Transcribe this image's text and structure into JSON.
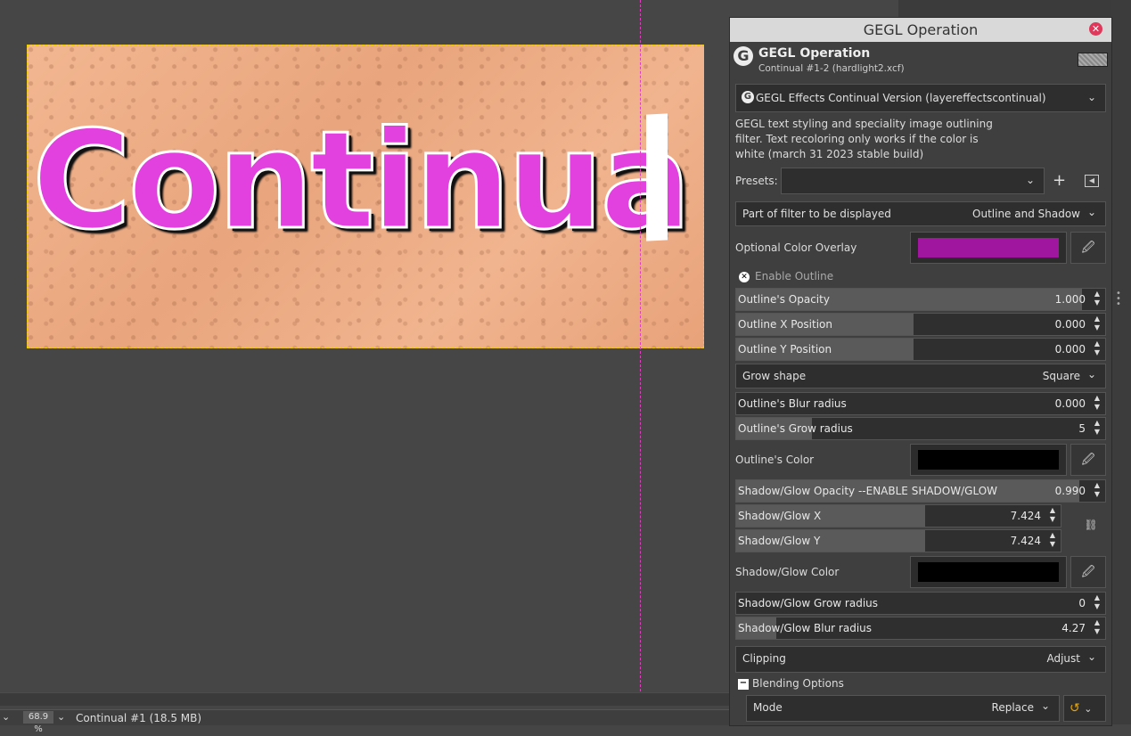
{
  "status": {
    "zoom": "68.9 %",
    "image_info": "Continual #1 (18.5 MB)"
  },
  "canvas": {
    "text": "Continua"
  },
  "dialog": {
    "title": "GEGL Operation",
    "op_title": "GEGL Operation",
    "op_subtitle": "Continual #1-2 (hardlight2.xcf)",
    "operation": "GEGL Effects Continual Version (layereffectscontinual)",
    "description": "GEGL text styling and speciality image outlining filter. Text recoloring only works if the color is white (march 31 2023 stable build)",
    "presets_label": "Presets:",
    "part_label": "Part of filter to be displayed",
    "part_value": "Outline and Shadow",
    "overlay_label": "Optional Color Overlay",
    "overlay_color": "#a0169e",
    "enable_outline": "Enable Outline",
    "outline_opacity_label": "Outline's Opacity",
    "outline_opacity": "1.000",
    "outline_x_label": "Outline X Position",
    "outline_x": "0.000",
    "outline_y_label": "Outline Y Position",
    "outline_y": "0.000",
    "grow_shape_label": "Grow shape",
    "grow_shape": "Square",
    "blur_label": "Outline's Blur radius",
    "blur": "0.000",
    "grow_label": "Outline's Grow radius",
    "grow": "5",
    "outline_color_label": "Outline's Color",
    "outline_color": "#000000",
    "shadow_opacity_label": "Shadow/Glow Opacity --ENABLE SHADOW/GLOW",
    "shadow_opacity": "0.990",
    "shadow_x_label": "Shadow/Glow X",
    "shadow_x": "7.424",
    "shadow_y_label": "Shadow/Glow Y",
    "shadow_y": "7.424",
    "shadow_color_label": "Shadow/Glow Color",
    "shadow_color": "#000000",
    "shadow_grow_label": "Shadow/Glow Grow radius",
    "shadow_grow": "0",
    "shadow_blur_label": "Shadow/Glow Blur radius",
    "shadow_blur": "4.27",
    "clipping_label": "Clipping",
    "clipping": "Adjust",
    "blending_label": "Blending Options",
    "mode_label": "Mode",
    "mode": "Replace"
  }
}
